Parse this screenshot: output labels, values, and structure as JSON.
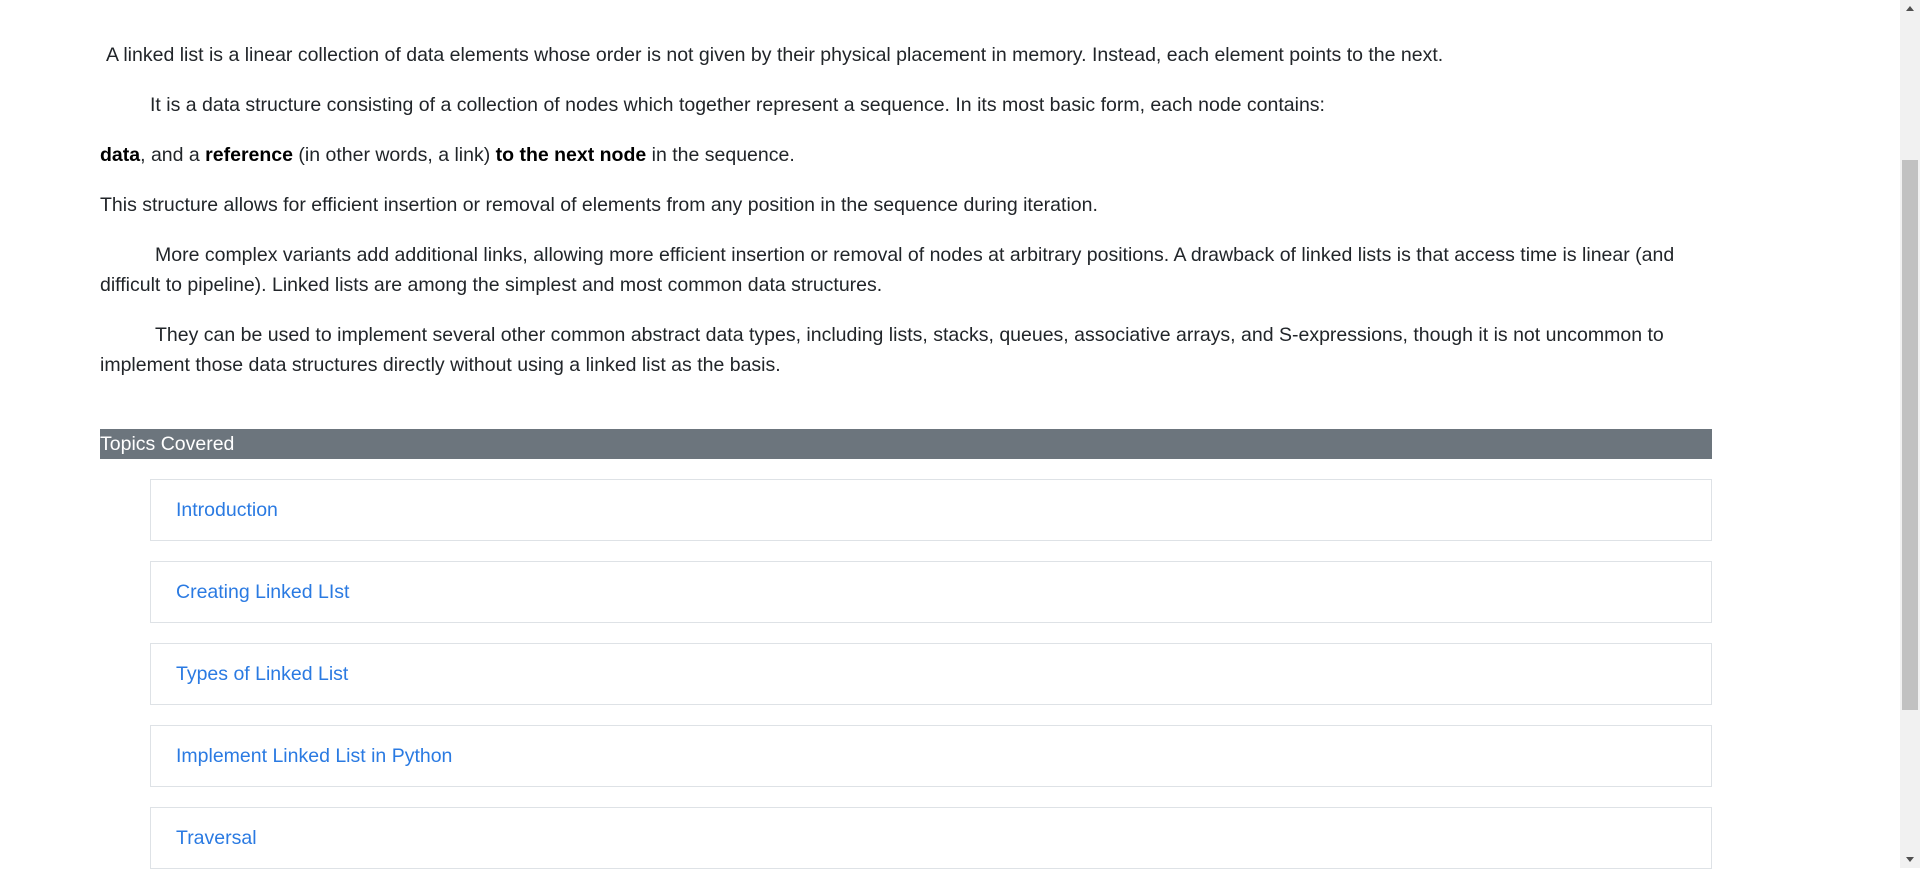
{
  "article": {
    "p1": "A linked list is a linear collection of data elements whose order is not given by their physical placement in memory. Instead, each element points to the next.",
    "p2": "It is a data structure consisting of a collection of nodes which together represent a sequence. In its most basic form, each node contains:",
    "p3": {
      "b1": "data",
      "t1": ", and a ",
      "b2": "reference",
      "t2": " (in other words, a link) ",
      "b3": "to the next node",
      "t3": " in the sequence."
    },
    "p4": "This structure allows for efficient insertion or removal of elements from any position in the sequence during iteration.",
    "p5": "More complex variants add additional links, allowing more efficient insertion or removal of nodes at arbitrary positions. A drawback of linked lists is that access time is linear (and difficult to pipeline). Linked lists are among the simplest and most common data structures.",
    "p6": "They can be used to implement several other common abstract data types, including lists, stacks, queues, associative arrays, and S-expressions, though it is not uncommon to implement those data structures directly without using a linked list as the basis."
  },
  "topics": {
    "header": "Topics Covered",
    "items": [
      "Introduction",
      "Creating Linked LIst",
      "Types of Linked List",
      "Implement Linked List in Python",
      "Traversal"
    ]
  },
  "colors": {
    "header_bg": "#6c757d",
    "link": "#2a7ae2",
    "text": "#212529"
  }
}
